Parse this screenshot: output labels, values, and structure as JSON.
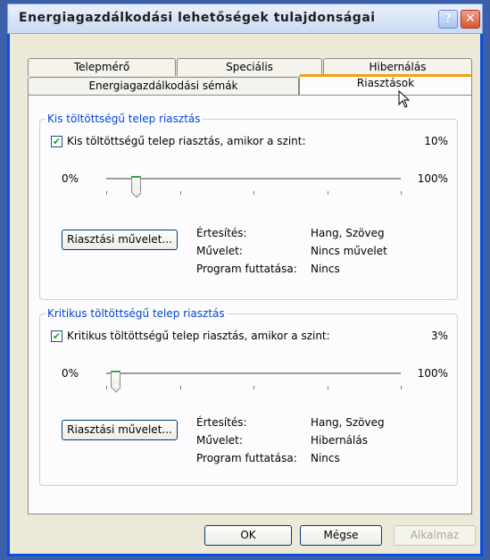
{
  "window": {
    "title": "Energiagazdálkodási lehetőségek tulajdonságai"
  },
  "tabs": {
    "row_top": [
      "Telepmérő",
      "Speciális",
      "Hibernálás"
    ],
    "row_bottom": [
      "Energiagazdálkodási sémák",
      "Riasztások"
    ],
    "active": "Riasztások"
  },
  "low_battery": {
    "legend": "Kis töltöttségű telep riasztás",
    "checkbox_label": "Kis töltöttségű telep riasztás, amikor a szint:",
    "checked": true,
    "level_text": "10%",
    "level_value": 10,
    "slider_min": "0%",
    "slider_max": "100%",
    "button_label": "Riasztási művelet...",
    "notify_label": "Értesítés:",
    "notify_value": "Hang, Szöveg",
    "action_label": "Művelet:",
    "action_value": "Nincs művelet",
    "program_label": "Program futtatása:",
    "program_value": "Nincs"
  },
  "critical_battery": {
    "legend": "Kritikus töltöttségű telep riasztás",
    "checkbox_label": "Kritikus töltöttségű telep riasztás, amikor a szint:",
    "checked": true,
    "level_text": "3%",
    "level_value": 3,
    "slider_min": "0%",
    "slider_max": "100%",
    "button_label": "Riasztási művelet...",
    "notify_label": "Értesítés:",
    "notify_value": "Hang, Szöveg",
    "action_label": "Művelet:",
    "action_value": "Hibernálás",
    "program_label": "Program futtatása:",
    "program_value": "Nincs"
  },
  "footer": {
    "ok": "OK",
    "cancel": "Mégse",
    "apply": "Alkalmaz"
  },
  "colors": {
    "accent": "#0046d5",
    "active_tab": "#f0a30a",
    "check": "#21a121"
  },
  "icons": {
    "help": "question-mark-icon",
    "close": "close-x-icon",
    "cursor": "mouse-pointer-icon"
  }
}
